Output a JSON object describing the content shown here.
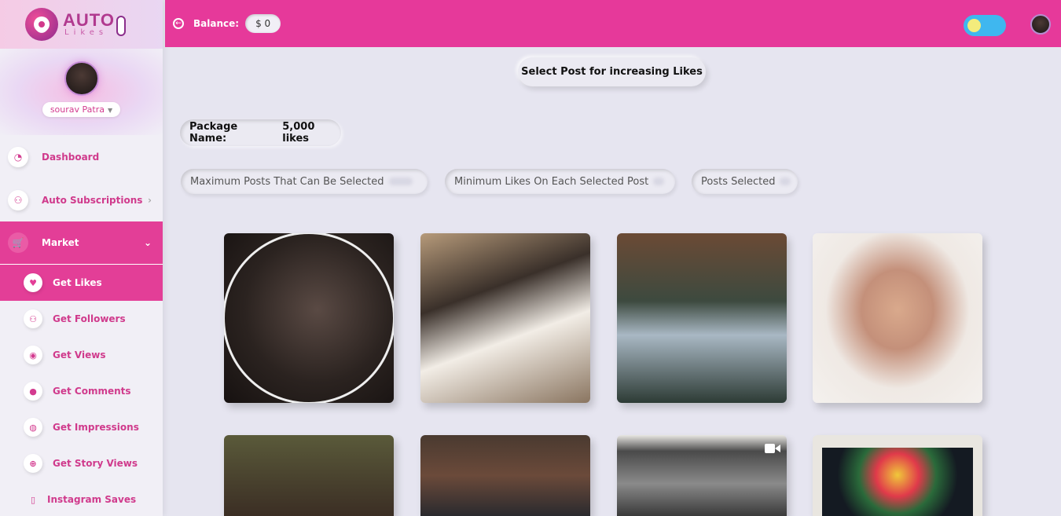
{
  "brand": {
    "title": "AUTO",
    "subtitle": "Likes"
  },
  "user": {
    "name": "sourav Patra"
  },
  "sidebar": {
    "items": [
      {
        "label": "Dashboard",
        "icon": "pie-chart-icon"
      },
      {
        "label": "Auto Subscriptions",
        "icon": "users-icon"
      },
      {
        "label": "Market",
        "icon": "cart-icon"
      }
    ],
    "sub_items": [
      {
        "label": "Get Likes",
        "icon": "heart-icon"
      },
      {
        "label": "Get Followers",
        "icon": "users-icon"
      },
      {
        "label": "Get Views",
        "icon": "eye-icon"
      },
      {
        "label": "Get Comments",
        "icon": "comments-icon"
      },
      {
        "label": "Get Impressions",
        "icon": "fire-icon"
      },
      {
        "label": "Get Story Views",
        "icon": "plus-circle-icon"
      },
      {
        "label": "Instagram Saves",
        "icon": "bookmark-icon"
      }
    ]
  },
  "topbar": {
    "balance_label": "Balance:",
    "balance_value": "$ 0"
  },
  "main": {
    "select_prompt": "Select Post for increasing Likes",
    "package_label": "Package Name:",
    "package_value": "5,000 likes",
    "max_posts_label": "Maximum Posts That Can Be Selected",
    "min_likes_label": "Minimum Likes On Each Selected Post",
    "posts_selected_label": "Posts Selected"
  },
  "colors": {
    "accent": "#e6399a",
    "sidebar_bg": "#f1eff6",
    "page_bg": "#e6e5f0",
    "toggle": "#3fb7ef"
  }
}
